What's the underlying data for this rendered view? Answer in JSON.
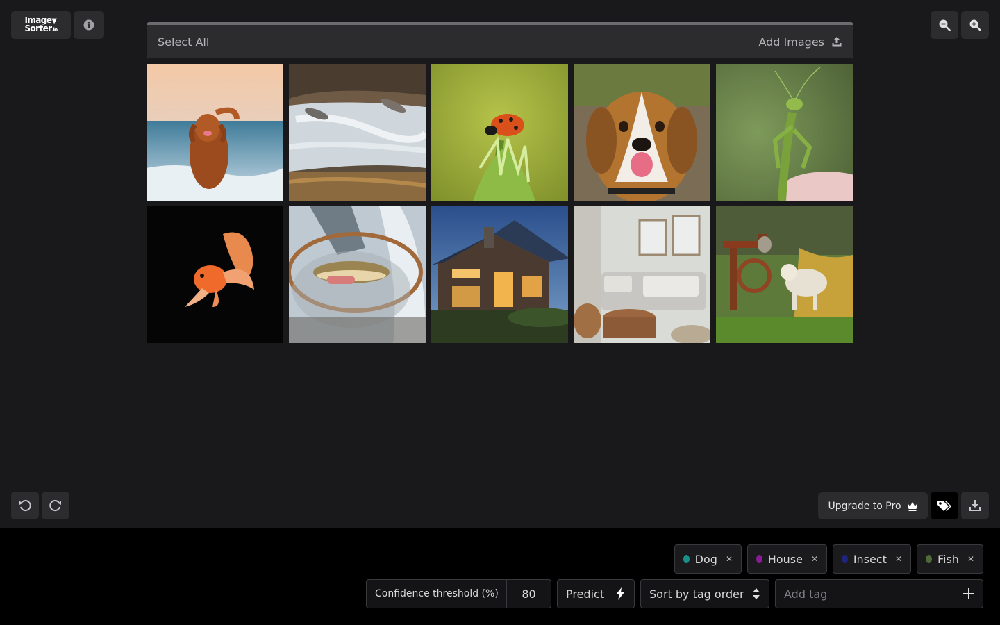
{
  "app": {
    "logo_line1": "Image",
    "logo_line2": "Sorter",
    "logo_suffix": ".io"
  },
  "toolbar": {
    "select_all": "Select All",
    "add_images": "Add Images"
  },
  "images": [
    {
      "name": "dog-beach"
    },
    {
      "name": "salmon-rapids"
    },
    {
      "name": "ladybug-flower"
    },
    {
      "name": "beagle-portrait"
    },
    {
      "name": "praying-mantis"
    },
    {
      "name": "goldfish"
    },
    {
      "name": "trout-net"
    },
    {
      "name": "house-night"
    },
    {
      "name": "living-room"
    },
    {
      "name": "dog-cat-farm"
    }
  ],
  "footer": {
    "upgrade_label": "Upgrade to Pro"
  },
  "tags": [
    {
      "label": "Dog",
      "color": "#1a8f8a"
    },
    {
      "label": "House",
      "color": "#8a1a96"
    },
    {
      "label": "Insect",
      "color": "#20247a"
    },
    {
      "label": "Fish",
      "color": "#4e6a3a"
    }
  ],
  "controls": {
    "confidence_label": "Confidence threshold (%)",
    "confidence_value": "80",
    "predict_label": "Predict",
    "sort_label": "Sort by tag order",
    "add_tag_placeholder": "Add tag"
  },
  "icons": {
    "info": "info-icon",
    "zoom_out": "zoom-out-icon",
    "zoom_in": "zoom-in-icon",
    "upload": "upload-icon",
    "undo": "undo-icon",
    "redo": "redo-icon",
    "crown": "crown-icon",
    "tags": "tags-icon",
    "download": "download-icon",
    "bolt": "bolt-icon",
    "sort": "sort-icon",
    "plus": "plus-icon"
  }
}
